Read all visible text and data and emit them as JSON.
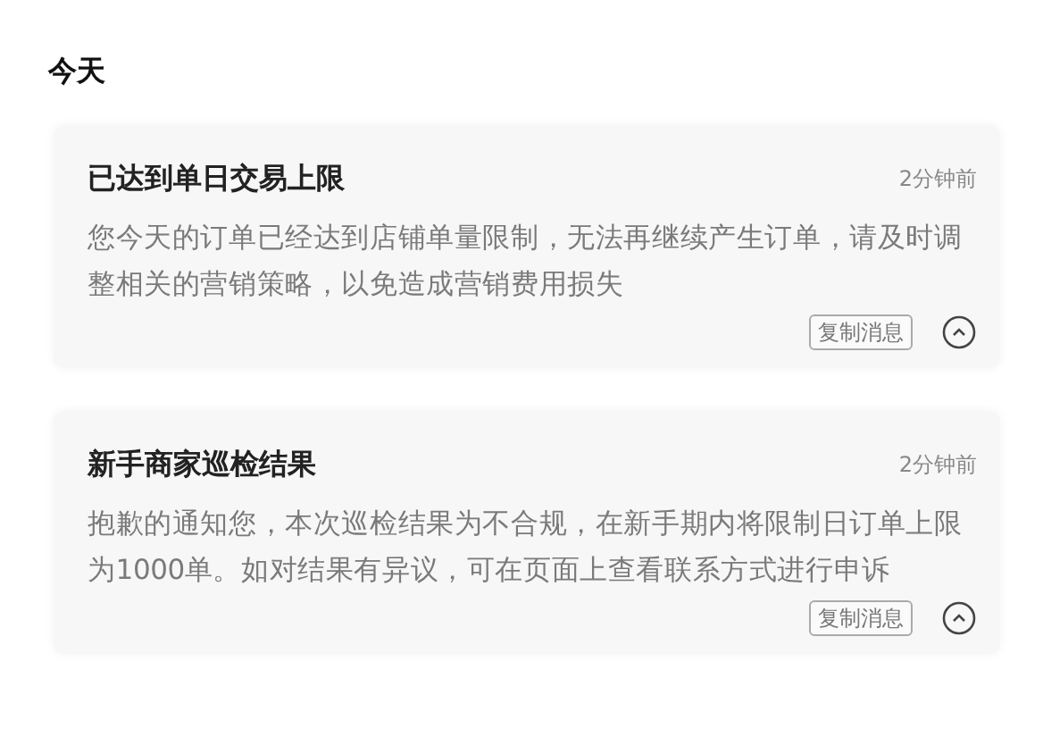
{
  "section_title": "今天",
  "messages": [
    {
      "title": "已达到单日交易上限",
      "time": "2分钟前",
      "body": "您今天的订单已经达到店铺单量限制，无法再继续产生订单，请及时调整相关的营销策略，以免造成营销费用损失",
      "copy_button": "复制消息",
      "expanded": true
    },
    {
      "title": "新手商家巡检结果",
      "time": "2分钟前",
      "body": "抱歉的通知您，本次巡检结果为不合规，在新手期内将限制日订单上限为1000单。如对结果有异议，可在页面上查看联系方式进行申诉",
      "copy_button": "复制消息",
      "expanded": true
    }
  ]
}
